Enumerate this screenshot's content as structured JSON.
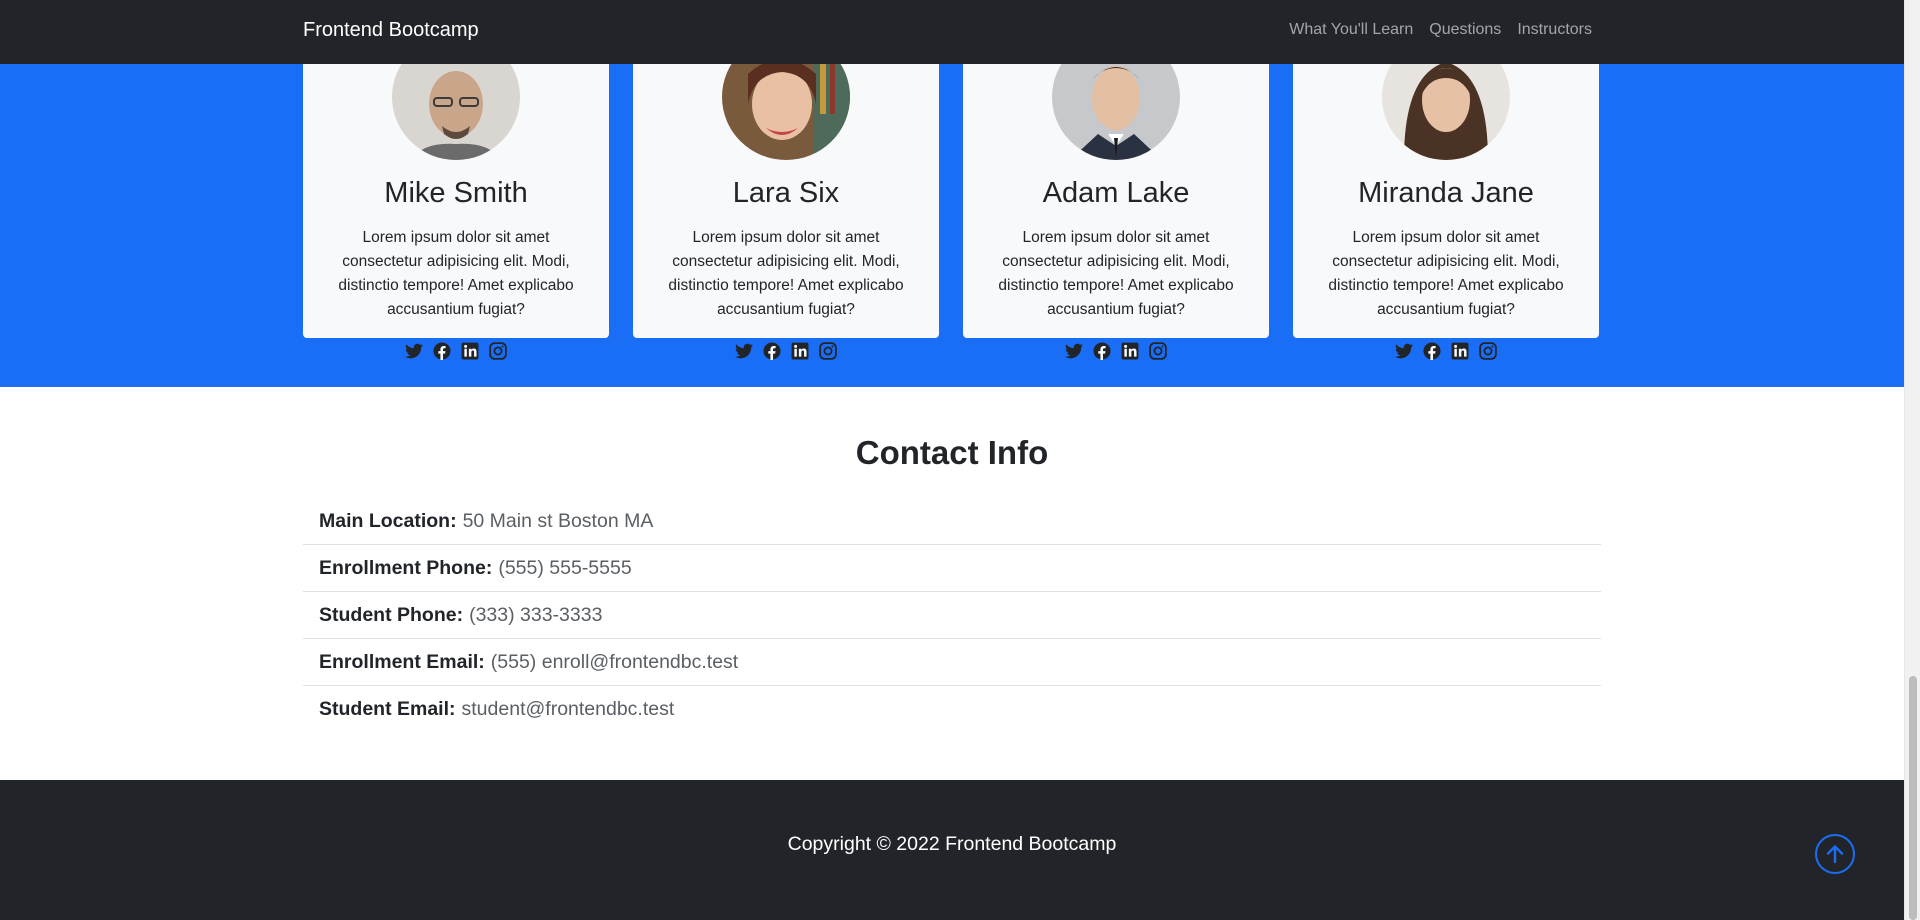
{
  "navbar": {
    "brand": "Frontend Bootcamp",
    "links": [
      "What You'll Learn",
      "Questions",
      "Instructors"
    ]
  },
  "instructors": [
    {
      "name": "Mike Smith",
      "bio": "Lorem ipsum dolor sit amet consectetur adipisicing elit. Modi, distinctio tempore! Amet explicabo accusantium fugiat?"
    },
    {
      "name": "Lara Six",
      "bio": "Lorem ipsum dolor sit amet consectetur adipisicing elit. Modi, distinctio tempore! Amet explicabo accusantium fugiat?"
    },
    {
      "name": "Adam Lake",
      "bio": "Lorem ipsum dolor sit amet consectetur adipisicing elit. Modi, distinctio tempore! Amet explicabo accusantium fugiat?"
    },
    {
      "name": "Miranda Jane",
      "bio": "Lorem ipsum dolor sit amet consectetur adipisicing elit. Modi, distinctio tempore! Amet explicabo accusantium fugiat?"
    }
  ],
  "social_icons": [
    "twitter-icon",
    "facebook-icon",
    "linkedin-icon",
    "instagram-icon"
  ],
  "contact": {
    "title": "Contact Info",
    "items": [
      {
        "label": "Main Location:",
        "value": "50 Main st Boston MA"
      },
      {
        "label": "Enrollment Phone:",
        "value": "(555) 555-5555"
      },
      {
        "label": "Student Phone:",
        "value": "(333) 333-3333"
      },
      {
        "label": "Enrollment Email:",
        "value": "(555) enroll@frontendbc.test"
      },
      {
        "label": "Student Email:",
        "value": "student@frontendbc.test"
      }
    ]
  },
  "footer": {
    "copyright": "Copyright © 2022 Frontend Bootcamp",
    "to_top_icon": "arrow-up-circle-icon"
  },
  "colors": {
    "primary": "#1a6ef5",
    "dark": "#212529",
    "card": "#f8f9fa"
  }
}
